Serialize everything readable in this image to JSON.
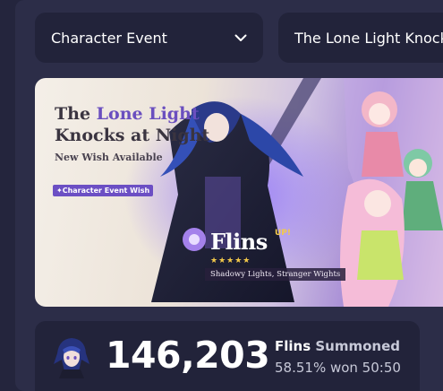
{
  "banner_selector": {
    "selected": "Character Event"
  },
  "event_selector": {
    "selected": "The Lone Light Knocks"
  },
  "banner": {
    "title_part1": "The ",
    "title_highlight": "Lone Light",
    "title_line2": "Knocks at Night",
    "subtitle": "New Wish Available",
    "tag": "✦Character Event Wish",
    "character_name": "Flins",
    "up_label": "UP!",
    "stars": "★★★★★",
    "weapon_text": "Shadowy Lights, Stranger Wights"
  },
  "stats": {
    "count": "146,203",
    "character": "Flins",
    "verb": " Summoned",
    "rate": "58.51% won 50:50"
  },
  "colors": {
    "page_bg": "#24253d",
    "panel_bg": "#2c2d48",
    "card_bg": "#22233a",
    "accent": "#6a4fbf",
    "gold": "#f3c94a"
  }
}
